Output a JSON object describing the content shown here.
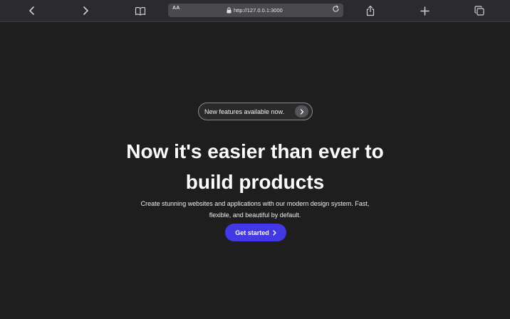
{
  "browser": {
    "reader_label": "AA",
    "url": "http://127.0.0.1:3000",
    "icons": {
      "back": "chevron-left-icon",
      "forward": "chevron-right-icon",
      "bookmarks": "book-icon",
      "lock": "lock-icon",
      "reload": "reload-icon",
      "share": "share-icon",
      "new_tab": "plus-icon",
      "tabs": "tabs-icon"
    }
  },
  "hero": {
    "announcement": "New features available now.",
    "headline_line1": "Now it's easier than ever to",
    "headline_line2": "build products",
    "description_line1": "Create stunning websites and applications with our modern design system. Fast,",
    "description_line2": "flexible, and beautiful by default.",
    "cta_label": "Get started"
  },
  "colors": {
    "background": "#1e1e1e",
    "toolbar": "#2b2b2d",
    "cta": "#4338e6"
  }
}
